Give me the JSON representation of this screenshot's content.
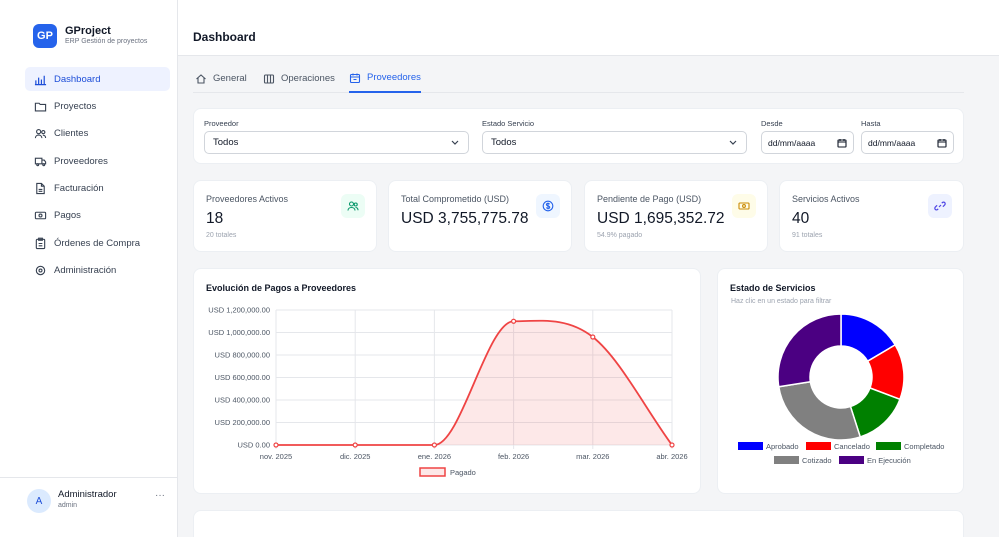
{
  "app": {
    "logo_text": "GP",
    "name": "GProject",
    "subtitle": "ERP Gestión de proyectos"
  },
  "sidebar": {
    "items": [
      {
        "label": "Dashboard",
        "icon": "bar-chart-icon",
        "active": true
      },
      {
        "label": "Proyectos",
        "icon": "folder-icon"
      },
      {
        "label": "Clientes",
        "icon": "users-icon"
      },
      {
        "label": "Proveedores",
        "icon": "truck-icon"
      },
      {
        "label": "Facturación",
        "icon": "file-icon"
      },
      {
        "label": "Pagos",
        "icon": "banknote-icon"
      },
      {
        "label": "Órdenes de Compra",
        "icon": "clipboard-icon"
      },
      {
        "label": "Administración",
        "icon": "settings-icon"
      }
    ]
  },
  "user": {
    "initial": "A",
    "name": "Administrador",
    "role": "admin",
    "menu": "···"
  },
  "header": {
    "title": "Dashboard"
  },
  "tabs": [
    {
      "label": "General",
      "icon": "home-icon"
    },
    {
      "label": "Operaciones",
      "icon": "columns-icon"
    },
    {
      "label": "Proveedores",
      "icon": "calendar-icon",
      "active": true
    }
  ],
  "filters": {
    "proveedor": {
      "label": "Proveedor",
      "value": "Todos"
    },
    "estado": {
      "label": "Estado Servicio",
      "value": "Todos"
    },
    "desde": {
      "label": "Desde",
      "value": "dd/mm/aaaa"
    },
    "hasta": {
      "label": "Hasta",
      "value": "dd/mm/aaaa"
    }
  },
  "kpis": [
    {
      "label": "Proveedores Activos",
      "value": "18",
      "sub": "20 totales",
      "icon": "users-icon",
      "icon_bg": "#ecfdf5",
      "icon_color": "#059669"
    },
    {
      "label": "Total Comprometido (USD)",
      "value": "USD 3,755,775.78",
      "sub": "",
      "icon": "dollar-circle-icon",
      "icon_bg": "#eff6ff",
      "icon_color": "#2563eb"
    },
    {
      "label": "Pendiente de Pago (USD)",
      "value": "USD 1,695,352.72",
      "sub": "54.9% pagado",
      "icon": "banknote-icon",
      "icon_bg": "#fefce8",
      "icon_color": "#ca8a04"
    },
    {
      "label": "Servicios Activos",
      "value": "40",
      "sub": "91 totales",
      "icon": "link-icon",
      "icon_bg": "#eef2ff",
      "icon_color": "#4f46e5"
    }
  ],
  "line_card": {
    "title": "Evolución de Pagos a Proveedores"
  },
  "donut_card": {
    "title": "Estado de Servicios",
    "subtitle": "Haz clic en un estado para filtrar"
  },
  "colors": {
    "accent": "#2563eb",
    "line": "#ef4444",
    "line_fill": "rgba(239,68,68,0.12)"
  },
  "chart_data": [
    {
      "type": "area",
      "title": "Evolución de Pagos a Proveedores",
      "x": [
        "nov. 2025",
        "dic. 2025",
        "ene. 2026",
        "feb. 2026",
        "mar. 2026",
        "abr. 2026"
      ],
      "series": [
        {
          "name": "Pagado",
          "values": [
            0,
            0,
            0,
            1100000,
            960000,
            0
          ],
          "color": "#ef4444"
        }
      ],
      "yticks": [
        "USD 0.00",
        "USD 200,000.00",
        "USD 400,000.00",
        "USD 600,000.00",
        "USD 800,000.00",
        "USD 1,000,000.00",
        "USD 1,200,000.00"
      ],
      "ylim": [
        0,
        1200000
      ],
      "grid": true,
      "legend": "bottom"
    },
    {
      "type": "pie",
      "title": "Estado de Servicios",
      "categories": [
        "Aprobado",
        "Cancelado",
        "Completado",
        "Cotizado",
        "En Ejecución"
      ],
      "values": [
        15,
        13,
        13,
        25,
        25
      ],
      "colors": [
        "#0000ff",
        "#ff0000",
        "#008000",
        "#808080",
        "#4b0082"
      ],
      "legend": "bottom"
    }
  ]
}
